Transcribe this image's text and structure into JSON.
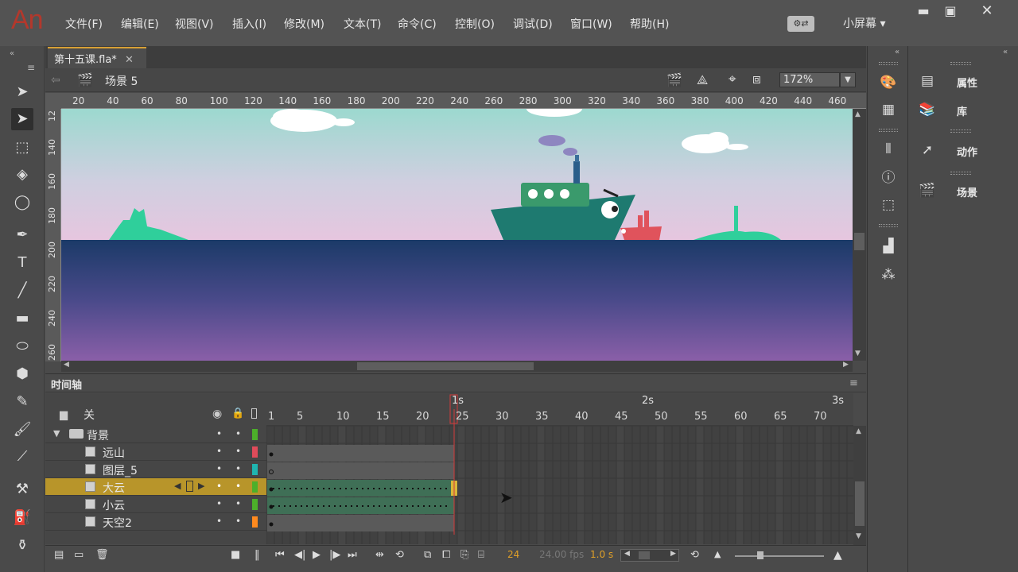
{
  "app": {
    "logo": "An"
  },
  "menu": [
    "文件(F)",
    "编辑(E)",
    "视图(V)",
    "插入(I)",
    "修改(M)",
    "文本(T)",
    "命令(C)",
    "控制(O)",
    "调试(D)",
    "窗口(W)",
    "帮助(H)"
  ],
  "layout": {
    "name": "小屏幕"
  },
  "document": {
    "tab": "第十五课.fla*",
    "scene": "场景 5",
    "zoom": "172%"
  },
  "ruler": {
    "h": [
      "20",
      "40",
      "60",
      "80",
      "100",
      "120",
      "140",
      "160",
      "180",
      "200",
      "220",
      "240",
      "260",
      "280",
      "300",
      "320",
      "340",
      "360",
      "380",
      "400",
      "420",
      "440",
      "460"
    ],
    "v": [
      "12",
      "140",
      "160",
      "180",
      "200",
      "220",
      "240",
      "260"
    ]
  },
  "timeline": {
    "title": "时间轴",
    "camera": "关",
    "frame_labels": [
      "1",
      "5",
      "10",
      "15",
      "20",
      "25",
      "30",
      "35",
      "40",
      "45",
      "50",
      "55",
      "60",
      "65",
      "70"
    ],
    "seconds": [
      "1s",
      "2s",
      "3s"
    ],
    "fps_frame": "24",
    "fps": "24.00 fps",
    "time": "1.0 s",
    "layers": [
      {
        "name": "背景",
        "type": "folder",
        "color": "#4caf2a"
      },
      {
        "name": "远山",
        "type": "layer",
        "color": "#e04b5a"
      },
      {
        "name": "图层_5",
        "type": "layer",
        "color": "#1fb5b0"
      },
      {
        "name": "大云",
        "type": "layer",
        "color": "#4caf2a",
        "active": true
      },
      {
        "name": "小云",
        "type": "layer",
        "color": "#4caf2a"
      },
      {
        "name": "天空2",
        "type": "layer",
        "color": "#ff8a1e"
      }
    ]
  },
  "panels": {
    "properties": "属性",
    "library": "库",
    "actions": "动作",
    "scene": "场景"
  }
}
